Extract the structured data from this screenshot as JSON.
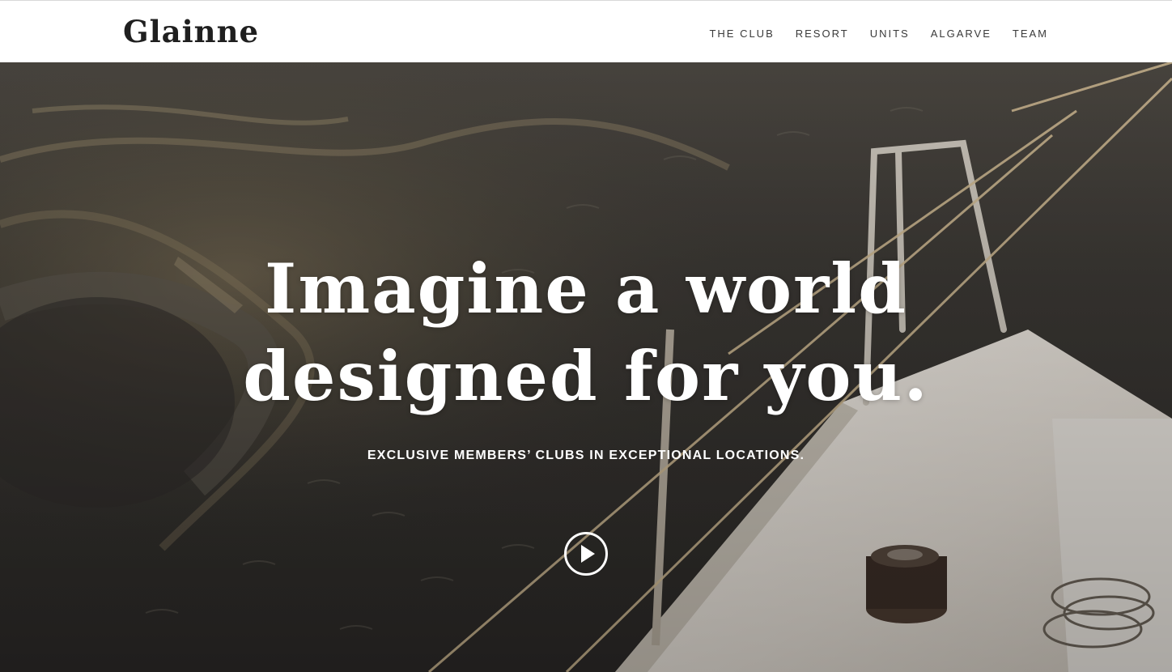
{
  "header": {
    "logo": "Glainne",
    "nav": [
      {
        "label": "THE CLUB"
      },
      {
        "label": "RESORT"
      },
      {
        "label": "UNITS"
      },
      {
        "label": "ALGARVE"
      },
      {
        "label": "TEAM"
      }
    ]
  },
  "hero": {
    "title_line1": "Imagine a world",
    "title_line2": "designed for you.",
    "subtitle": "EXCLUSIVE MEMBERS’ CLUBS IN EXCEPTIONAL LOCATIONS.",
    "play_icon": "play-icon"
  },
  "colors": {
    "header_bg": "#ffffff",
    "logo": "#1f1f1f",
    "nav_text": "#3a3a3a",
    "hero_text": "#ffffff"
  }
}
